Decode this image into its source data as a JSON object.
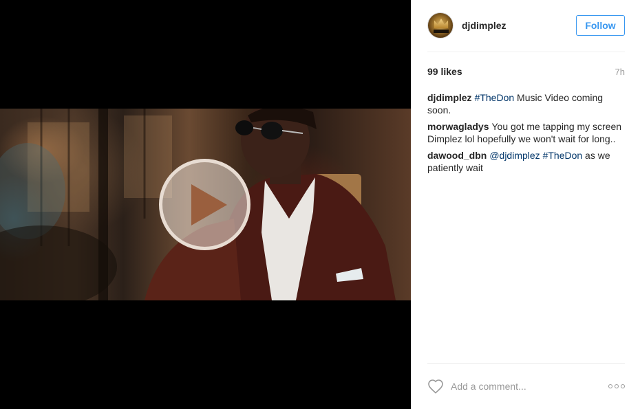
{
  "media": {
    "type": "video",
    "play_icon": "play-icon"
  },
  "post": {
    "username": "djdimplez",
    "follow_label": "Follow",
    "likes": "99 likes",
    "time": "7h",
    "comments": [
      {
        "user": "djdimplez",
        "parts": [
          {
            "text": "#TheDon",
            "tag": true
          },
          {
            "text": " Music Video coming soon.",
            "tag": false
          }
        ]
      },
      {
        "user": "morwagladys",
        "parts": [
          {
            "text": "You got me tapping my screen Dimplez lol hopefully we won't wait for long..",
            "tag": false
          }
        ]
      },
      {
        "user": "dawood_dbn",
        "parts": [
          {
            "text": "@djdimplez",
            "tag": true
          },
          {
            "text": " ",
            "tag": false
          },
          {
            "text": "#TheDon",
            "tag": true
          },
          {
            "text": " as we patiently wait",
            "tag": false
          }
        ]
      }
    ],
    "add_comment_placeholder": "Add a comment...",
    "icons": {
      "like": "heart-icon",
      "more": "more-options-icon"
    }
  },
  "colors": {
    "accent": "#3897f0",
    "hashtag": "#003569",
    "muted": "#999999"
  }
}
